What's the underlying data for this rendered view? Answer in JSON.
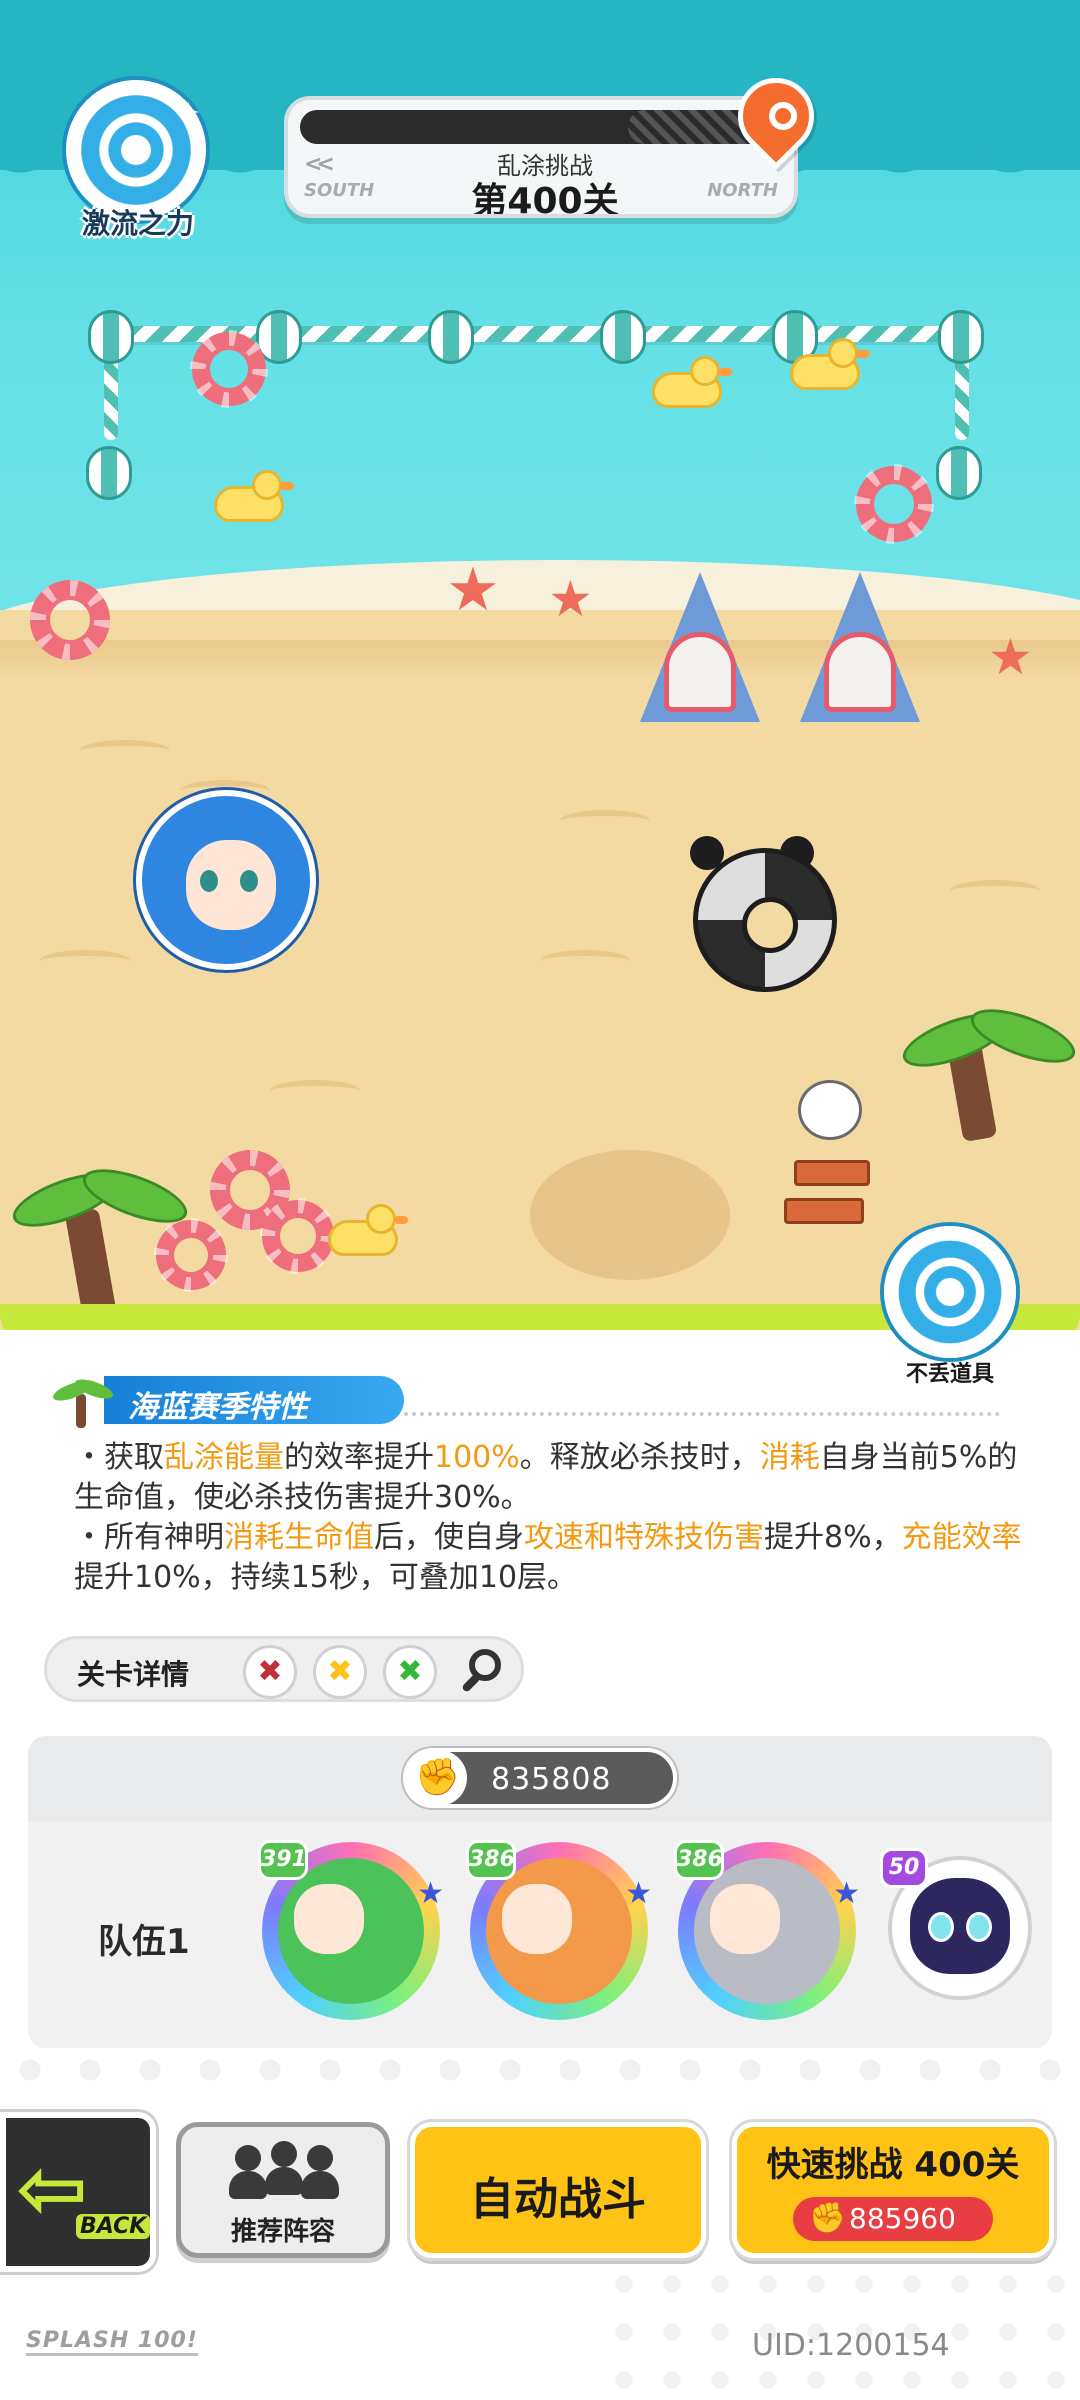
{
  "header": {
    "power_badge_label": "激流之力",
    "mode_title": "乱涂挑战",
    "stage_label": "第400关",
    "south_label": "SOUTH",
    "north_label": "NORTH",
    "prev_chevron": "<<"
  },
  "keep_item_badge": "不丢道具",
  "season": {
    "title": "海蓝赛季特性",
    "line1": [
      {
        "t": "・获取",
        "hl": false
      },
      {
        "t": "乱涂能量",
        "hl": true
      },
      {
        "t": "的效率提升",
        "hl": false
      },
      {
        "t": "100%",
        "hl": true
      },
      {
        "t": "。释放必杀技时，",
        "hl": false
      },
      {
        "t": "消耗",
        "hl": true
      },
      {
        "t": "自身当前5%的生命值，使必杀技伤害提升30%。",
        "hl": false
      }
    ],
    "line2": [
      {
        "t": "・所有神明",
        "hl": false
      },
      {
        "t": "消耗生命值",
        "hl": true
      },
      {
        "t": "后，使自身",
        "hl": false
      },
      {
        "t": "攻速和特殊技伤害",
        "hl": true
      },
      {
        "t": "提升8%，",
        "hl": false
      },
      {
        "t": "充能效率",
        "hl": true
      },
      {
        "t": "提升10%，持续15秒，可叠加10层。",
        "hl": false
      }
    ],
    "highlight_color": "#f29a12"
  },
  "stage_details": {
    "label": "关卡详情",
    "icons": [
      "red-cross-icon",
      "yellow-cross-icon",
      "green-cross-icon",
      "magnifier-icon"
    ],
    "cross_colors": [
      "#c0303a",
      "#ffc315",
      "#34b93a"
    ]
  },
  "team": {
    "power_value": "835808",
    "label": "队伍1",
    "heroes": [
      {
        "level": "391"
      },
      {
        "level": "386"
      },
      {
        "level": "386"
      }
    ],
    "pet_level": "50"
  },
  "buttons": {
    "back": "BACK",
    "recommend": "推荐阵容",
    "auto_battle": "自动战斗",
    "quick_challenge": "快速挑战 400关",
    "quick_cost": "885960"
  },
  "footer": {
    "logo": "SPLASH 100!",
    "uid": "UID:1200154"
  },
  "colors": {
    "accent_yellow": "#ffc315",
    "slime_green": "#c6e83a",
    "season_blue": "#1780d8",
    "cost_red": "#e83d42"
  }
}
